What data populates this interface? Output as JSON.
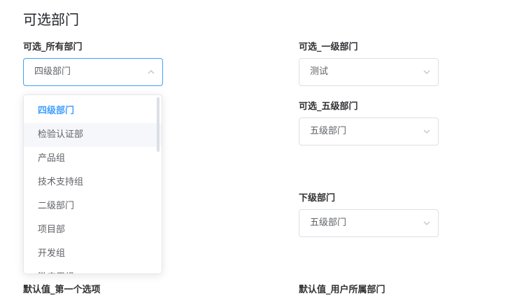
{
  "page": {
    "title": "可选部门"
  },
  "fields": {
    "all_dept": {
      "label": "可选_所有部门",
      "value": "四级部门"
    },
    "level1_dept": {
      "label": "可选_一级部门",
      "value": "测试"
    },
    "level5_dept": {
      "label": "可选_五级部门",
      "value": "五级部门"
    },
    "sub_dept": {
      "label": "下级部门",
      "value": "五级部门"
    },
    "default_first": {
      "label": "默认值_第一个选项"
    },
    "default_user_dept": {
      "label": "默认值_用户所属部门"
    }
  },
  "dropdown": {
    "options": [
      "四级部门",
      "检验认证部",
      "产品组",
      "技术支持组",
      "二级部门",
      "项目部",
      "开发组",
      "微应用组"
    ],
    "selected_index": 0,
    "hover_index": 1
  },
  "colors": {
    "accent": "#409eff",
    "border": "#dcdfe6",
    "text": "#606266",
    "hover_bg": "#f5f7fa"
  },
  "icons": {
    "chevron_up": "chevron-up-icon",
    "chevron_down": "chevron-down-icon"
  }
}
